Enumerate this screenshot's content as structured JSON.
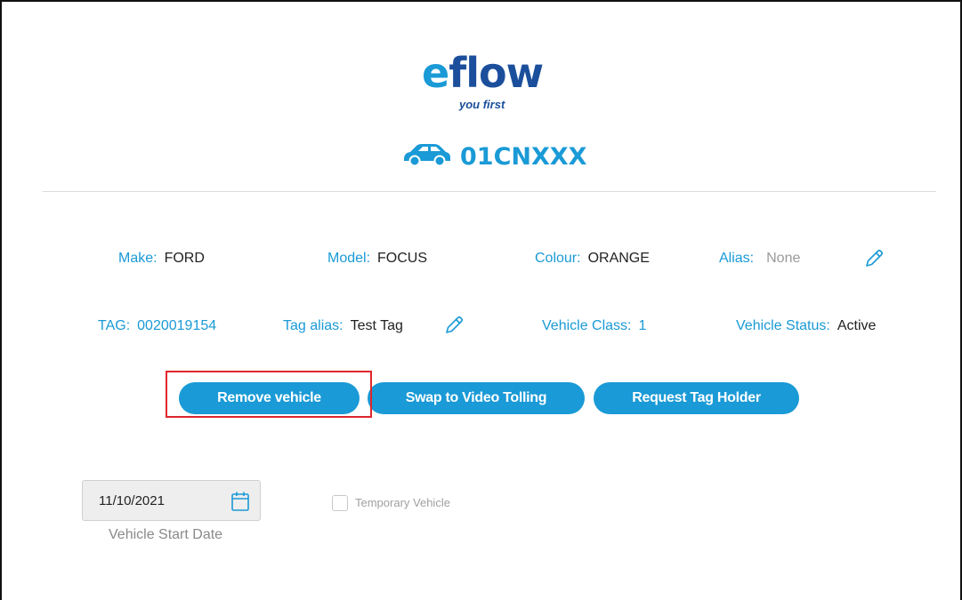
{
  "logo": {
    "word_e": "e",
    "word_rest": "flow",
    "tagline": "you first"
  },
  "vehicle": {
    "plate": "01CNXXX"
  },
  "details": {
    "make": {
      "label": "Make:",
      "value": "FORD"
    },
    "model": {
      "label": "Model:",
      "value": "FOCUS"
    },
    "colour": {
      "label": "Colour:",
      "value": "ORANGE"
    },
    "alias": {
      "label": "Alias:",
      "value": "None"
    },
    "tag": {
      "label": "TAG:",
      "value": "0020019154"
    },
    "tag_alias": {
      "label": "Tag alias:",
      "value": "Test Tag"
    },
    "vehicle_class": {
      "label": "Vehicle Class:",
      "value": "1"
    },
    "vehicle_status": {
      "label": "Vehicle Status:",
      "value": "Active"
    }
  },
  "buttons": {
    "remove": "Remove vehicle",
    "swap": "Swap to Video Tolling",
    "request": "Request Tag Holder"
  },
  "start_date": {
    "value": "11/10/2021",
    "label": "Vehicle Start Date"
  },
  "temporary": {
    "label": "Temporary Vehicle",
    "checked": false
  },
  "colors": {
    "accent": "#1a9ad6",
    "brand_dark": "#1b4f9c",
    "highlight": "#e0262b"
  },
  "icons": {
    "car": "car-icon",
    "pencil": "pencil-icon",
    "calendar": "calendar-icon"
  }
}
